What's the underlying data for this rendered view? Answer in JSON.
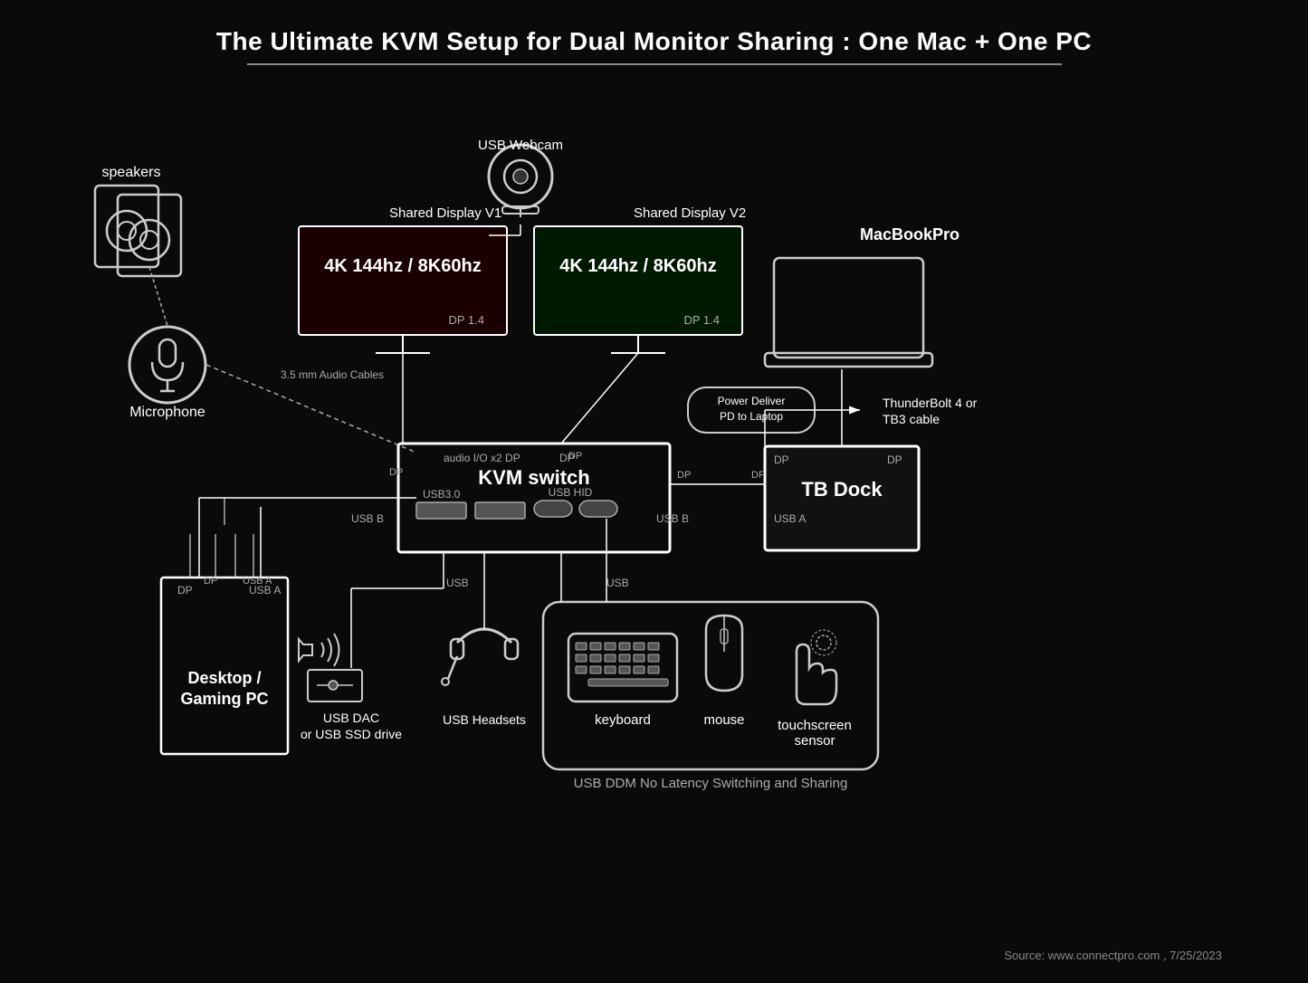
{
  "title": "The Ultimate KVM Setup for Dual Monitor Sharing  : One Mac + One PC",
  "source": "Source: www.connectpro.com , 7/25/2023",
  "components": {
    "speakers": "speakers",
    "microphone": "Microphone",
    "audio_cables": "3.5 mm Audio Cables",
    "webcam": "USB Webcam",
    "display1_label": "Shared Display V1",
    "display1_spec": "4K 144hz  / 8K60hz",
    "display1_port": "DP 1.4",
    "display2_label": "Shared Display V2",
    "display2_spec": "4K 144hz  / 8K60hz",
    "display2_port": "DP 1.4",
    "macbook": "MacBookPro",
    "power_deliver": "Power Deliver\nPD to Laptop",
    "thunderbolt": "ThunderBolt 4 or\nTB3 cable",
    "kvm_label": "KVM switch",
    "kvm_audio": "audio I/O x2  DP",
    "kvm_dp": "DP",
    "kvm_usb30": "USB3.0",
    "kvm_usb_hid": "USB HID",
    "kvm_usb_b": "USB B",
    "tb_dock": "TB Dock",
    "tb_dp1": "DP",
    "tb_dp2": "DP",
    "tb_usb_b": "USB B",
    "tb_usb_a": "USB A",
    "desktop": "Desktop /\nGaming PC",
    "desktop_dp": "DP",
    "desktop_usba": "USB A",
    "usb_dac": "USB DAC\nor USB SSD drive",
    "usb_headsets": "USB Headsets",
    "keyboard": "keyboard",
    "mouse": "mouse",
    "touchscreen": "touchscreen\nsensor",
    "usb_ddm": "USB DDM No Latency Switching and Sharing",
    "kvm_dp_left": "DP",
    "kvm_dp_right": "DP"
  }
}
